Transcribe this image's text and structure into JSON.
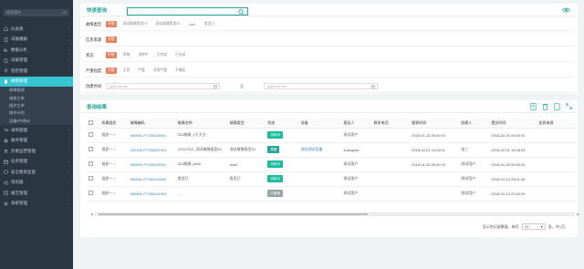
{
  "sidebar": {
    "search_placeholder": "搜索模块",
    "items": [
      {
        "label": "仪表盘",
        "icon": "home-icon",
        "has_arrow": false
      },
      {
        "label": "日报播报",
        "icon": "clipboard-icon",
        "has_arrow": false
      },
      {
        "label": "数据分析",
        "icon": "chart-icon",
        "has_arrow": false
      },
      {
        "label": "日报管理",
        "icon": "document-icon",
        "has_arrow": false
      },
      {
        "label": "巡检管理",
        "icon": "location-icon",
        "has_arrow": true
      },
      {
        "label": "故障管理",
        "icon": "file-icon",
        "has_arrow": true,
        "active": true
      }
    ],
    "subitems": [
      "故障管理",
      "维修工单",
      "维护工单",
      "维护计划",
      "设备KPI统计"
    ],
    "items2": [
      {
        "label": "采购管理",
        "icon": "cart-icon"
      },
      {
        "label": "备件管理",
        "icon": "gear-icon"
      },
      {
        "label": "外委运营管理",
        "icon": "users-icon"
      },
      {
        "label": "任务管理",
        "icon": "calendar-icon"
      },
      {
        "label": "安全教育监督",
        "icon": "shield-icon"
      },
      {
        "label": "资讯版",
        "icon": "megaphone-icon"
      },
      {
        "label": "报告管理",
        "icon": "report-icon"
      },
      {
        "label": "系统管理",
        "icon": "settings-icon"
      }
    ]
  },
  "filter_panel": {
    "title": "快速查询",
    "rows": [
      {
        "label": "故障类型",
        "options": [
          "不限",
          "测试故障类型01",
          "测试故障类型01",
          "lela2",
          "类型已"
        ]
      },
      {
        "label": "信息来源",
        "options": [
          "不限"
        ]
      },
      {
        "label": "状态",
        "options": [
          "不限",
          "草稿",
          "流转中",
          "已完成",
          "已关闭"
        ]
      },
      {
        "label": "严重程度",
        "options": [
          "不限",
          "正常",
          "严重",
          "非常严重",
          "不确定"
        ]
      }
    ],
    "date_row": {
      "label": "创建时间",
      "from_placeholder": "yyyy-mm-dd",
      "separator": "至",
      "to_placeholder": "yyyy-mm-dd"
    }
  },
  "results": {
    "title": "查询结果",
    "columns": [
      "所属组织",
      "故障编码",
      "故障名称",
      "故障类型",
      "状态",
      "设备",
      "报告人",
      "联系电话",
      "报到时间",
      "创建人",
      "提交时间",
      "信息来源"
    ],
    "rows": [
      {
        "org": "组织一",
        "code": "000001-FT180126001",
        "name": "321故障_1大大大",
        "type": "",
        "status": "流转中",
        "status_color": "#1bbc9b",
        "device": "",
        "reporter": "测试用户",
        "phone": "",
        "report_time": "2018-01-25 00:50:10",
        "creator": "",
        "submit_time": "2018-02-26 00:50:31",
        "source": ""
      },
      {
        "org": "组织一",
        "code": "100100-FT180201001",
        "name": "21312312_测试故障类型01",
        "type": "测试故障类型01",
        "status": "草稿",
        "status_color": "#26a69a",
        "device": "测试测试设备",
        "reporter": "zhangsan",
        "phone": "",
        "report_time": "2018-02-01 14:25:11",
        "creator": "张三",
        "submit_time": "2018-02-01 14:28:04",
        "source": ""
      },
      {
        "org": "组织一",
        "code": "000001-FT180125001",
        "name": "321故障_lela2",
        "type": "lela2",
        "status": "流转中",
        "status_color": "#1bbc9b",
        "device": "",
        "reporter": "测试用户",
        "phone": "",
        "report_time": "2018-01-25 00:50:10",
        "creator": "测试用户",
        "submit_time": "2018-01-25 00:50:33",
        "source": ""
      },
      {
        "org": "组织一",
        "code": "000001-FT180124002",
        "name": "类型已",
        "type": "类型已",
        "status": "流转中",
        "status_color": "#1bbc9b",
        "device": "",
        "reporter": "测试用户",
        "phone": "",
        "report_time": "",
        "creator": "测试用户",
        "submit_time": "2018-01-24 23:01:40",
        "source": ""
      },
      {
        "org": "组织一",
        "code": "000001-FT180124001",
        "name": "...",
        "type": "",
        "status": "已撤销",
        "status_color": "#95a5a6",
        "device": "",
        "reporter": "测试用户",
        "phone": "",
        "report_time": "",
        "creator": "测试用户",
        "submit_time": "2018-01-24 22:54:00",
        "source": ""
      }
    ],
    "pager": {
      "total_text": "显示的记录数量，每页",
      "page_size": "10",
      "suffix": "条，共1页"
    }
  },
  "colors": {
    "sidebar_bg": "#2b3643",
    "accent": "#26a69a",
    "active": "#36c6d3",
    "tag_selected": "#e7825e"
  }
}
